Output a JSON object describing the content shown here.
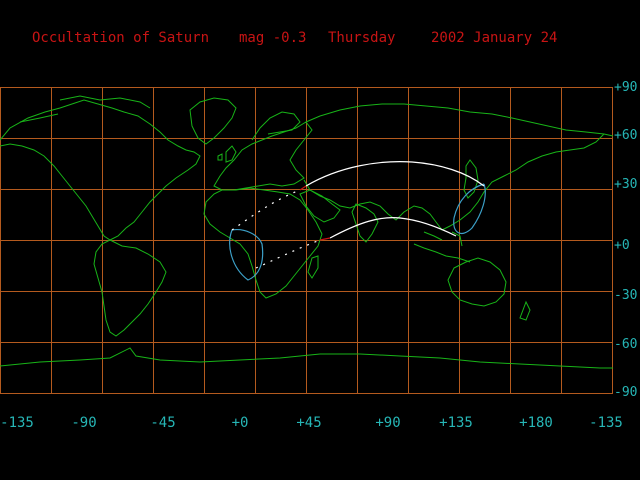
{
  "header": {
    "title": "Occultation of Saturn",
    "magnitude": "mag -0.3",
    "weekday": "Thursday",
    "date": "2002 January 24"
  },
  "lat_labels": [
    "+90",
    "+60",
    "+30",
    "+0",
    "-30",
    "-60",
    "-90"
  ],
  "lon_labels": [
    "-135",
    "-90",
    "-45",
    "+0",
    "+45",
    "+90",
    "+135",
    "+180",
    "-135"
  ],
  "colors": {
    "background": "#000000",
    "grid": "#b45a1e",
    "coastline": "#18b418",
    "occultation_path": "#ffffff",
    "visibility_limit": "#3ca0c8",
    "header_text": "#c81414",
    "axis_labels": "#26b6b6"
  }
}
